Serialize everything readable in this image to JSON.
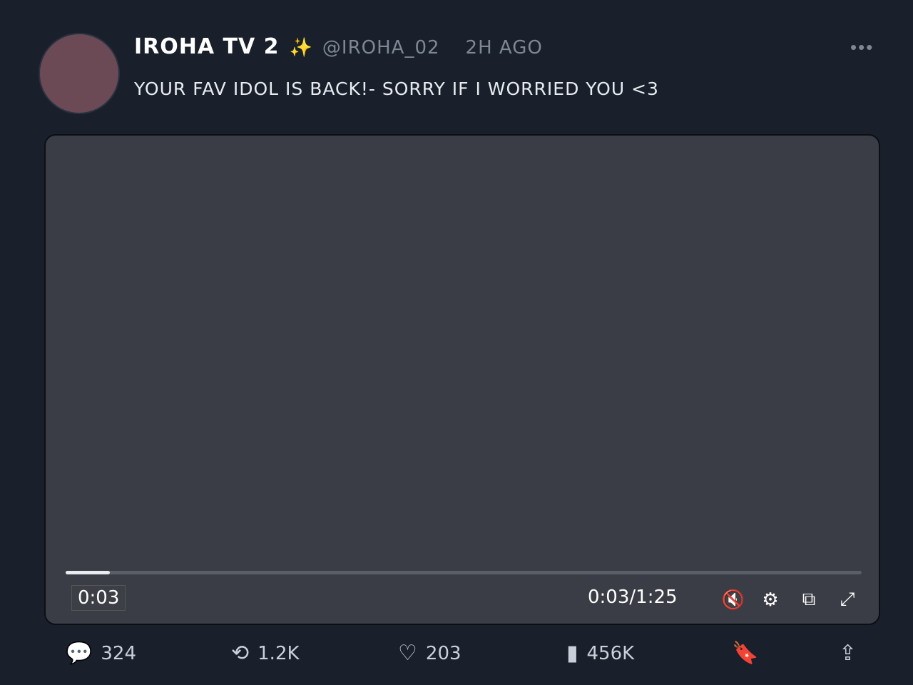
{
  "post": {
    "author_name": "IROHA TV 2",
    "sparkle": "✨",
    "handle": "@IROHA_02",
    "time_ago": "2H AGO",
    "more": "•••",
    "text": "YOUR FAV IDOL IS BACK!- SORRY IF I WORRIED YOU <3"
  },
  "video": {
    "current_time": "0:03",
    "readout": "0:03/1:25",
    "progress_fraction": 0.056,
    "icons": [
      "mute-icon",
      "settings-icon",
      "pip-icon",
      "fullscreen-icon"
    ]
  },
  "actions": {
    "replies": "324",
    "reposts": "1.2K",
    "likes": "203",
    "views": "456K"
  }
}
